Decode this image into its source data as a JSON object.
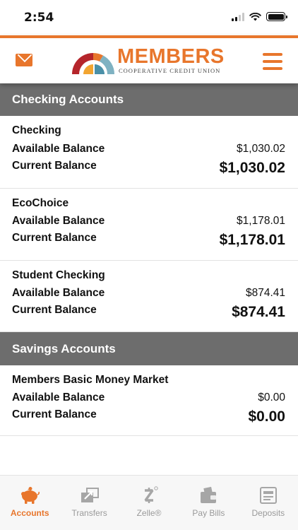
{
  "status": {
    "time": "2:54"
  },
  "header": {
    "logo_name": "MEMBERS",
    "logo_sub": "COOPERATIVE CREDIT UNION",
    "accent_color": "#e8762c"
  },
  "checking": {
    "title": "Checking Accounts",
    "accounts": [
      {
        "name": "Checking",
        "available_label": "Available Balance",
        "available": "$1,030.02",
        "current_label": "Current Balance",
        "current": "$1,030.02"
      },
      {
        "name": "EcoChoice",
        "available_label": "Available Balance",
        "available": "$1,178.01",
        "current_label": "Current Balance",
        "current": "$1,178.01"
      },
      {
        "name": "Student Checking",
        "available_label": "Available Balance",
        "available": "$874.41",
        "current_label": "Current Balance",
        "current": "$874.41"
      }
    ]
  },
  "savings": {
    "title": "Savings Accounts",
    "accounts": [
      {
        "name": "Members Basic Money Market",
        "available_label": "Available Balance",
        "available": "$0.00",
        "current_label": "Current Balance",
        "current": "$0.00"
      }
    ]
  },
  "tabs": [
    {
      "label": "Accounts",
      "icon": "piggy-bank-icon",
      "active": true
    },
    {
      "label": "Transfers",
      "icon": "transfer-icon",
      "active": false
    },
    {
      "label": "Zelle®",
      "icon": "zelle-icon",
      "active": false
    },
    {
      "label": "Pay Bills",
      "icon": "wallet-icon",
      "active": false
    },
    {
      "label": "Deposits",
      "icon": "check-deposit-icon",
      "active": false
    }
  ]
}
